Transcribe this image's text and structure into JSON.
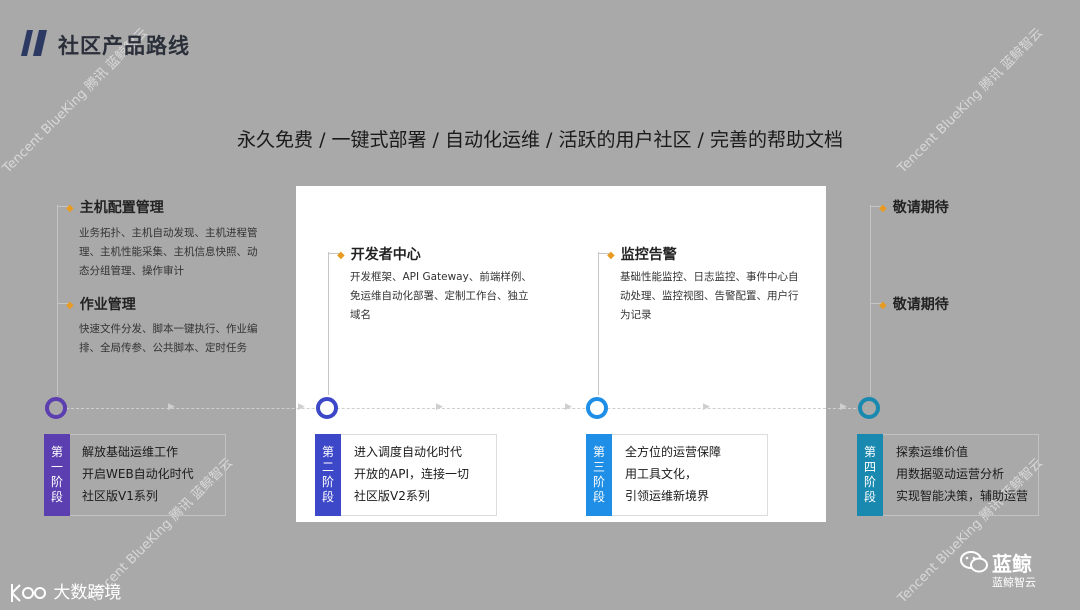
{
  "header": {
    "title": "社区产品路线"
  },
  "subtitle": "永久免费 / 一键式部署 / 自动化运维 / 活跃的用户社区 / 完善的帮助文档",
  "watermark": {
    "text": "Tencent BlueKing 腾讯 蓝鲸智云"
  },
  "blocks": [
    {
      "title": "主机配置管理",
      "lines": [
        "业务拓扑、主机自动发现、主机进程管",
        "理、主机性能采集、主机信息快照、动",
        "态分组管理、操作审计"
      ]
    },
    {
      "title": "作业管理",
      "lines": [
        "快速文件分发、脚本一键执行、作业编",
        "排、全局传参、公共脚本、定时任务"
      ]
    },
    {
      "title": "开发者中心",
      "lines": [
        "开发框架、API Gateway、前端样例、",
        "免运维自动化部署、定制工作台、独立",
        "域名"
      ]
    },
    {
      "title": "监控告警",
      "lines": [
        "基础性能监控、日志监控、事件中心自",
        "动处理、监控视图、告警配置、用户行",
        "为记录"
      ]
    },
    {
      "title": "敬请期待",
      "lines": []
    },
    {
      "title": "敬请期待",
      "lines": []
    }
  ],
  "stages": [
    {
      "tag": [
        "第",
        "一",
        "阶",
        "段"
      ],
      "color": "#5b3fb0",
      "lines": [
        "解放基础运维工作",
        "开启WEB自动化时代",
        "社区版V1系列"
      ]
    },
    {
      "tag": [
        "第",
        "二",
        "阶",
        "段"
      ],
      "color": "#3d48c9",
      "lines": [
        "进入调度自动化时代",
        "开放的API，连接一切",
        "社区版V2系列"
      ]
    },
    {
      "tag": [
        "第",
        "三",
        "阶",
        "段"
      ],
      "color": "#1f8ee6",
      "lines": [
        "全方位的运营保障",
        "用工具文化，",
        "引领运维新境界"
      ]
    },
    {
      "tag": [
        "第",
        "四",
        "阶",
        "段"
      ],
      "color": "#1a89b0",
      "lines": [
        "探索运维价值",
        "用数据驱动运营分析",
        "实现智能决策，辅助运营"
      ]
    }
  ],
  "footer": {
    "logo_text": "大数跨境",
    "brand_name": "蓝鲸",
    "brand_sub": "蓝鲸智云"
  }
}
